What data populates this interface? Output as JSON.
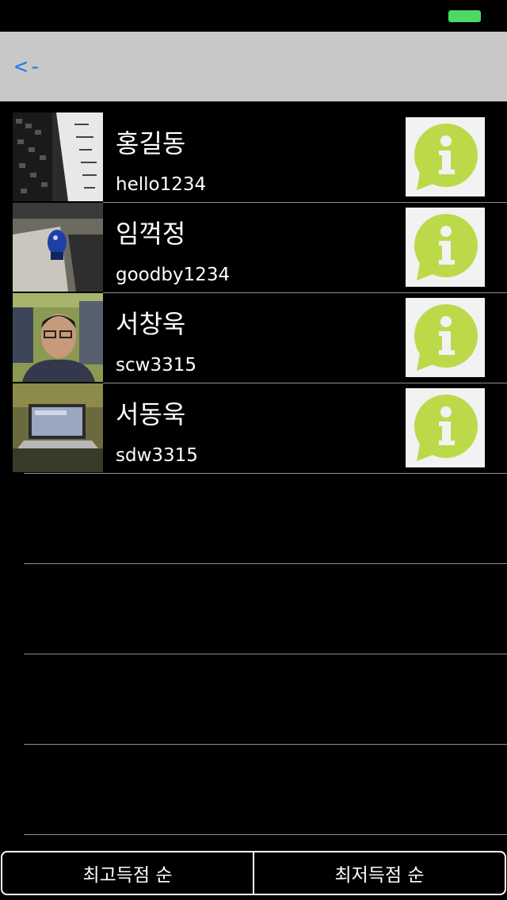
{
  "nav": {
    "back_label": "<-"
  },
  "users": [
    {
      "name": "홍길동",
      "id": "hello1234"
    },
    {
      "name": "임꺽정",
      "id": "goodby1234"
    },
    {
      "name": "서창욱",
      "id": "scw3315"
    },
    {
      "name": "서동욱",
      "id": "sdw3315"
    }
  ],
  "sort": {
    "highest_label": "최고득점 순",
    "lowest_label": "최저득점 순"
  },
  "colors": {
    "nav_background": "#c8c8c8",
    "back_link": "#1e7cf5",
    "battery": "#4cd964",
    "info_icon": "#bcd94a"
  }
}
